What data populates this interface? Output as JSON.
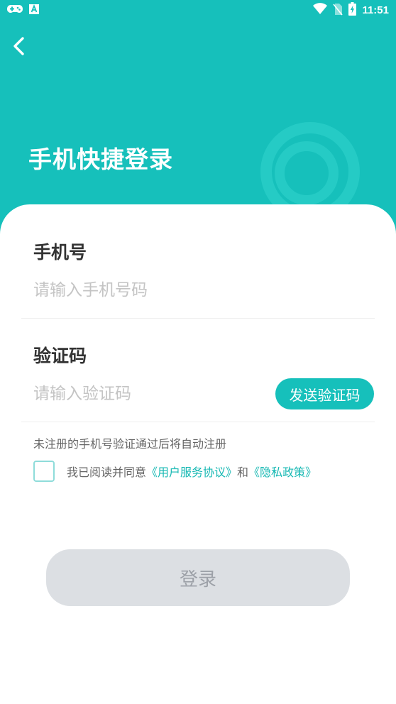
{
  "status_bar": {
    "time": "11:51",
    "left_icons": [
      "gamepad-icon",
      "app-a-icon"
    ],
    "right_icons": [
      "wifi-icon",
      "no-sim-icon",
      "battery-charging-icon"
    ]
  },
  "header": {
    "back_icon": "chevron-left-icon",
    "title": "手机快捷登录",
    "background_color": "#16c0bb"
  },
  "form": {
    "phone": {
      "label": "手机号",
      "placeholder": "请输入手机号码",
      "value": ""
    },
    "code": {
      "label": "验证码",
      "placeholder": "请输入验证码",
      "value": "",
      "send_button": "发送验证码"
    },
    "hint": "未注册的手机号验证通过后将自动注册",
    "agreement": {
      "checked": false,
      "prefix": "我已阅读并同意",
      "link1": "《用户服务协议》",
      "middle": "和",
      "link2": "《隐私政策》"
    },
    "login_button": "登录"
  },
  "colors": {
    "accent": "#16c0bb",
    "disabled_button": "#dcdfe3",
    "link": "#16b8b3"
  }
}
